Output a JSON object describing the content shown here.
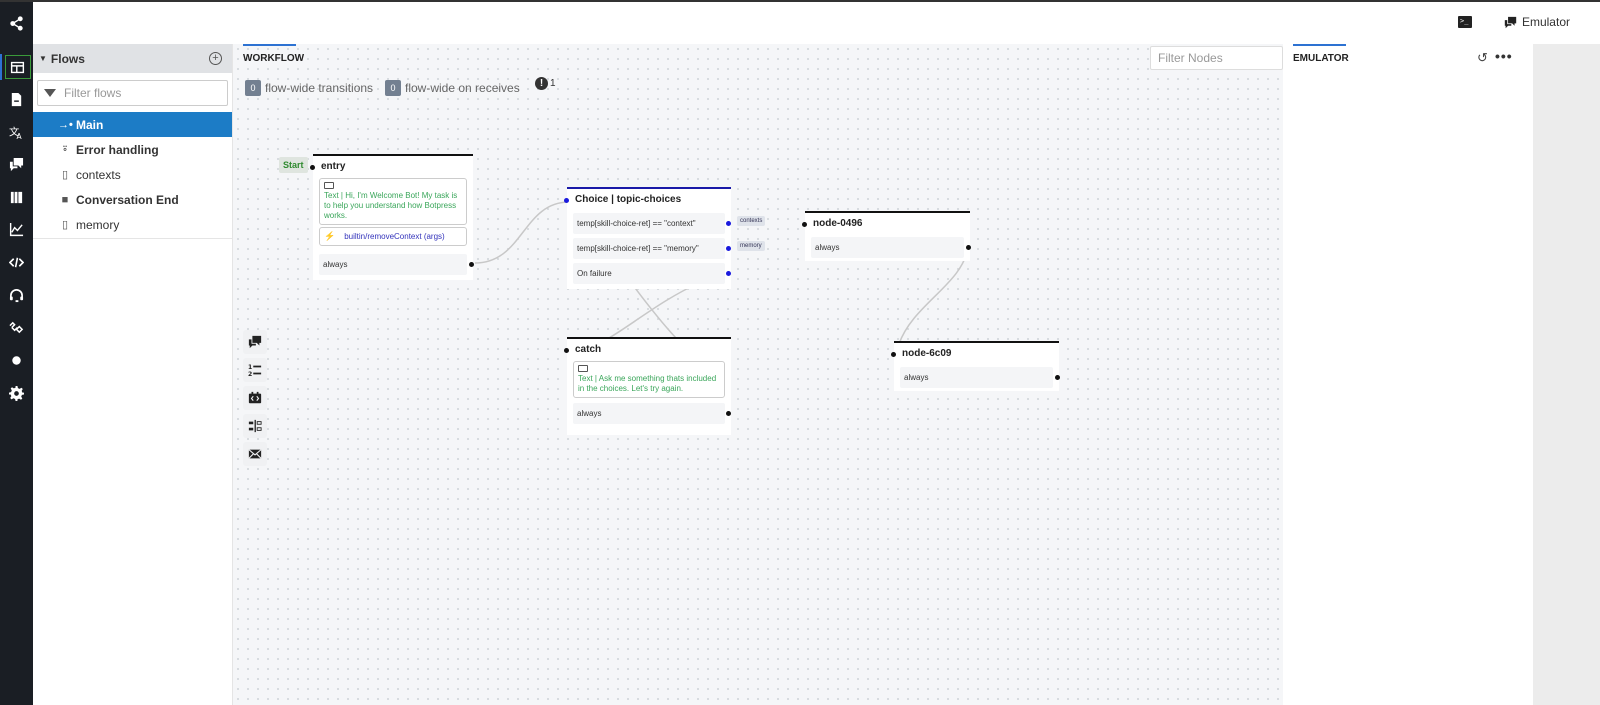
{
  "iconbar": {
    "items": [
      {
        "name": "share-icon"
      },
      {
        "name": "flows-icon",
        "active": true
      },
      {
        "name": "content-icon"
      },
      {
        "name": "translate-icon"
      },
      {
        "name": "qna-icon"
      },
      {
        "name": "library-icon"
      },
      {
        "name": "analytics-icon"
      },
      {
        "name": "code-editor-icon"
      },
      {
        "name": "support-icon"
      },
      {
        "name": "nlu-icon"
      },
      {
        "name": "dot-icon"
      },
      {
        "name": "settings-icon"
      }
    ]
  },
  "topbar": {
    "emulator_label": "Emulator"
  },
  "sidebar": {
    "title": "Flows",
    "filter_placeholder": "Filter flows",
    "items": [
      {
        "label": "Main",
        "icon": "→•",
        "bold": true,
        "active": true
      },
      {
        "label": "Error handling",
        "icon": "⚲",
        "bold": true
      },
      {
        "label": "contexts",
        "icon": "🗋",
        "bold": false
      },
      {
        "label": "Conversation End",
        "icon": "■",
        "bold": true
      },
      {
        "label": "memory",
        "icon": "🗋",
        "bold": false
      }
    ]
  },
  "workflow": {
    "tab_label": "WORKFLOW",
    "transitions_count": "0",
    "transitions_label": "flow-wide transitions",
    "receives_count": "0",
    "receives_label": "flow-wide on receives",
    "warning_count": "1",
    "filter_nodes_placeholder": "Filter Nodes",
    "start_label": "Start",
    "nodes": {
      "entry": {
        "title": "entry",
        "content": "Text | Hi, I'm Welcome Bot! My task is to help you understand how Botpress works.",
        "action": "builtin/removeContext (args)",
        "transition": "always"
      },
      "choice": {
        "title": "Choice | topic-choices",
        "transitions": [
          {
            "label": "temp[skill-choice-ret] == \"context\"",
            "target": "contexts"
          },
          {
            "label": "temp[skill-choice-ret] == \"memory\"",
            "target": "memory"
          },
          {
            "label": "On failure",
            "target": ""
          }
        ]
      },
      "node0496": {
        "title": "node-0496",
        "transition": "always"
      },
      "catch": {
        "title": "catch",
        "content": "Text | Ask me something thats included in the choices. Let's try again.",
        "transition": "always"
      },
      "node6c09": {
        "title": "node-6c09",
        "transition": "always"
      }
    },
    "tools": [
      {
        "name": "say-something-tool-icon"
      },
      {
        "name": "list-tool-icon"
      },
      {
        "name": "code-tool-icon"
      },
      {
        "name": "router-tool-icon"
      },
      {
        "name": "action-tool-icon"
      }
    ]
  },
  "emulator": {
    "tab_label": "EMULATOR",
    "reset_icon": "↺",
    "more_icon": "•••"
  }
}
